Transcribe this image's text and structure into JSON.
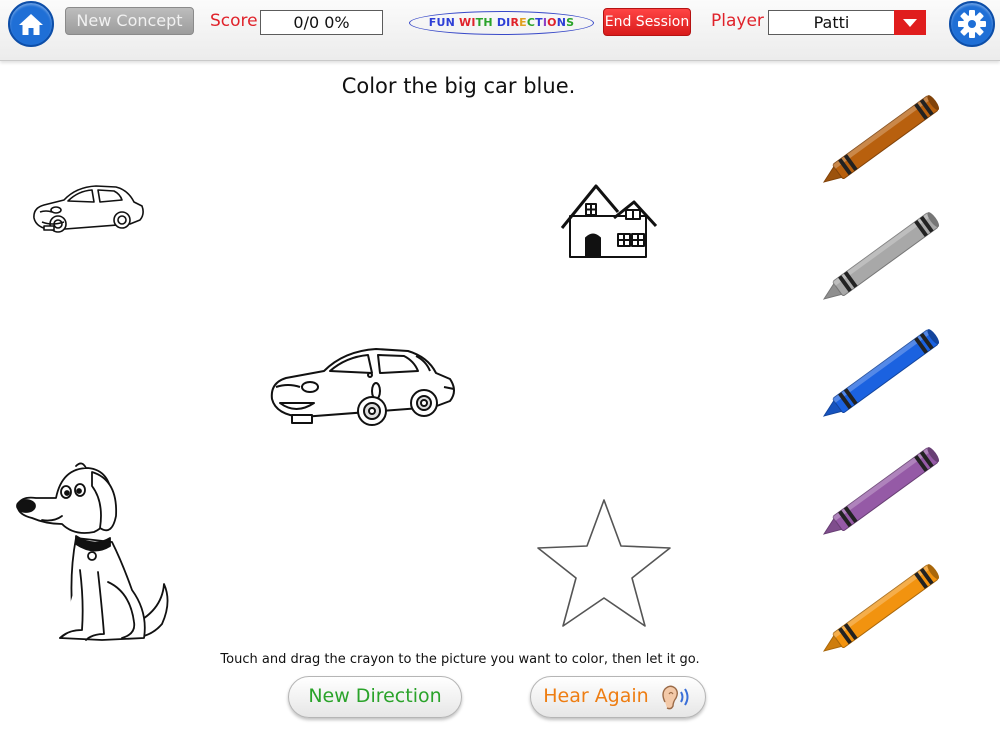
{
  "header": {
    "new_concept_label": "New Concept",
    "score_label": "Score",
    "score_value": "0/0  0%",
    "app_title_letters": [
      {
        "ch": "F",
        "color": "#2e3fd6"
      },
      {
        "ch": "U",
        "color": "#2e3fd6"
      },
      {
        "ch": "N",
        "color": "#2e3fd6"
      },
      {
        "ch": " ",
        "color": "#2e3fd6"
      },
      {
        "ch": "W",
        "color": "#e0222a"
      },
      {
        "ch": "I",
        "color": "#e0222a"
      },
      {
        "ch": "T",
        "color": "#2aa32a"
      },
      {
        "ch": "H",
        "color": "#2aa32a"
      },
      {
        "ch": " ",
        "color": "#2e3fd6"
      },
      {
        "ch": "D",
        "color": "#2e3fd6"
      },
      {
        "ch": "I",
        "color": "#2e3fd6"
      },
      {
        "ch": "R",
        "color": "#e0222a"
      },
      {
        "ch": "E",
        "color": "#e0a020"
      },
      {
        "ch": "C",
        "color": "#2aa32a"
      },
      {
        "ch": "T",
        "color": "#2e3fd6"
      },
      {
        "ch": "I",
        "color": "#8b3fc6"
      },
      {
        "ch": "O",
        "color": "#e0222a"
      },
      {
        "ch": "N",
        "color": "#2e3fd6"
      },
      {
        "ch": "S",
        "color": "#2aa32a"
      }
    ],
    "end_session_label": "End Session",
    "player_label": "Player",
    "player_value": "Patti",
    "home_icon": "home-icon",
    "settings_icon": "gear-icon"
  },
  "instruction": "Color the big car blue.",
  "pictures": [
    "small-car",
    "house",
    "big-car",
    "dog",
    "star"
  ],
  "crayons": [
    {
      "name": "brown",
      "color": "#b8600e"
    },
    {
      "name": "gray",
      "color": "#a8a8a8"
    },
    {
      "name": "blue",
      "color": "#1b62e0"
    },
    {
      "name": "purple",
      "color": "#955aa6"
    },
    {
      "name": "orange",
      "color": "#f2930f"
    }
  ],
  "hint": "Touch and drag the crayon to the picture you want to color, then let it go.",
  "buttons": {
    "new_direction": "New Direction",
    "new_direction_color": "#2aa32a",
    "hear_again": "Hear Again",
    "hear_again_color": "#ee7d12",
    "hear_again_icon": "ear-sound-icon"
  }
}
